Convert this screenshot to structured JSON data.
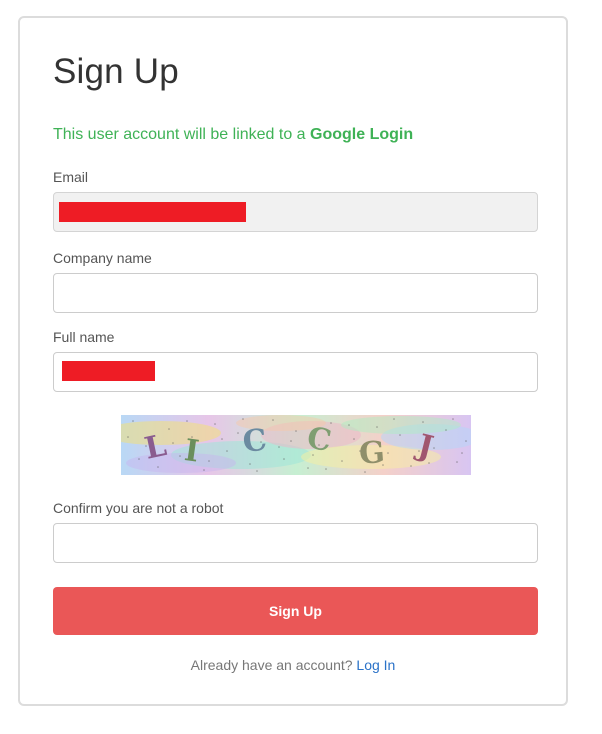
{
  "page": {
    "title": "Sign Up",
    "linked_text": "This user account will be linked to a",
    "linked_provider": "Google Login"
  },
  "form": {
    "email_label": "Email",
    "email_value": "",
    "company_label": "Company name",
    "company_value": "",
    "fullname_label": "Full name",
    "fullname_value": "",
    "captcha_text": "LICCGJ",
    "robot_label": "Confirm you are not a robot",
    "robot_value": "",
    "submit_label": "Sign Up"
  },
  "footer": {
    "prompt": "Already have an account?",
    "login_link": "Log In"
  },
  "colors": {
    "accent_green": "#3fb256",
    "button_red": "#ea5757",
    "link_blue": "#2a72c8",
    "redaction": "#ee1c25"
  },
  "icons": {
    "captcha": "captcha-image"
  }
}
